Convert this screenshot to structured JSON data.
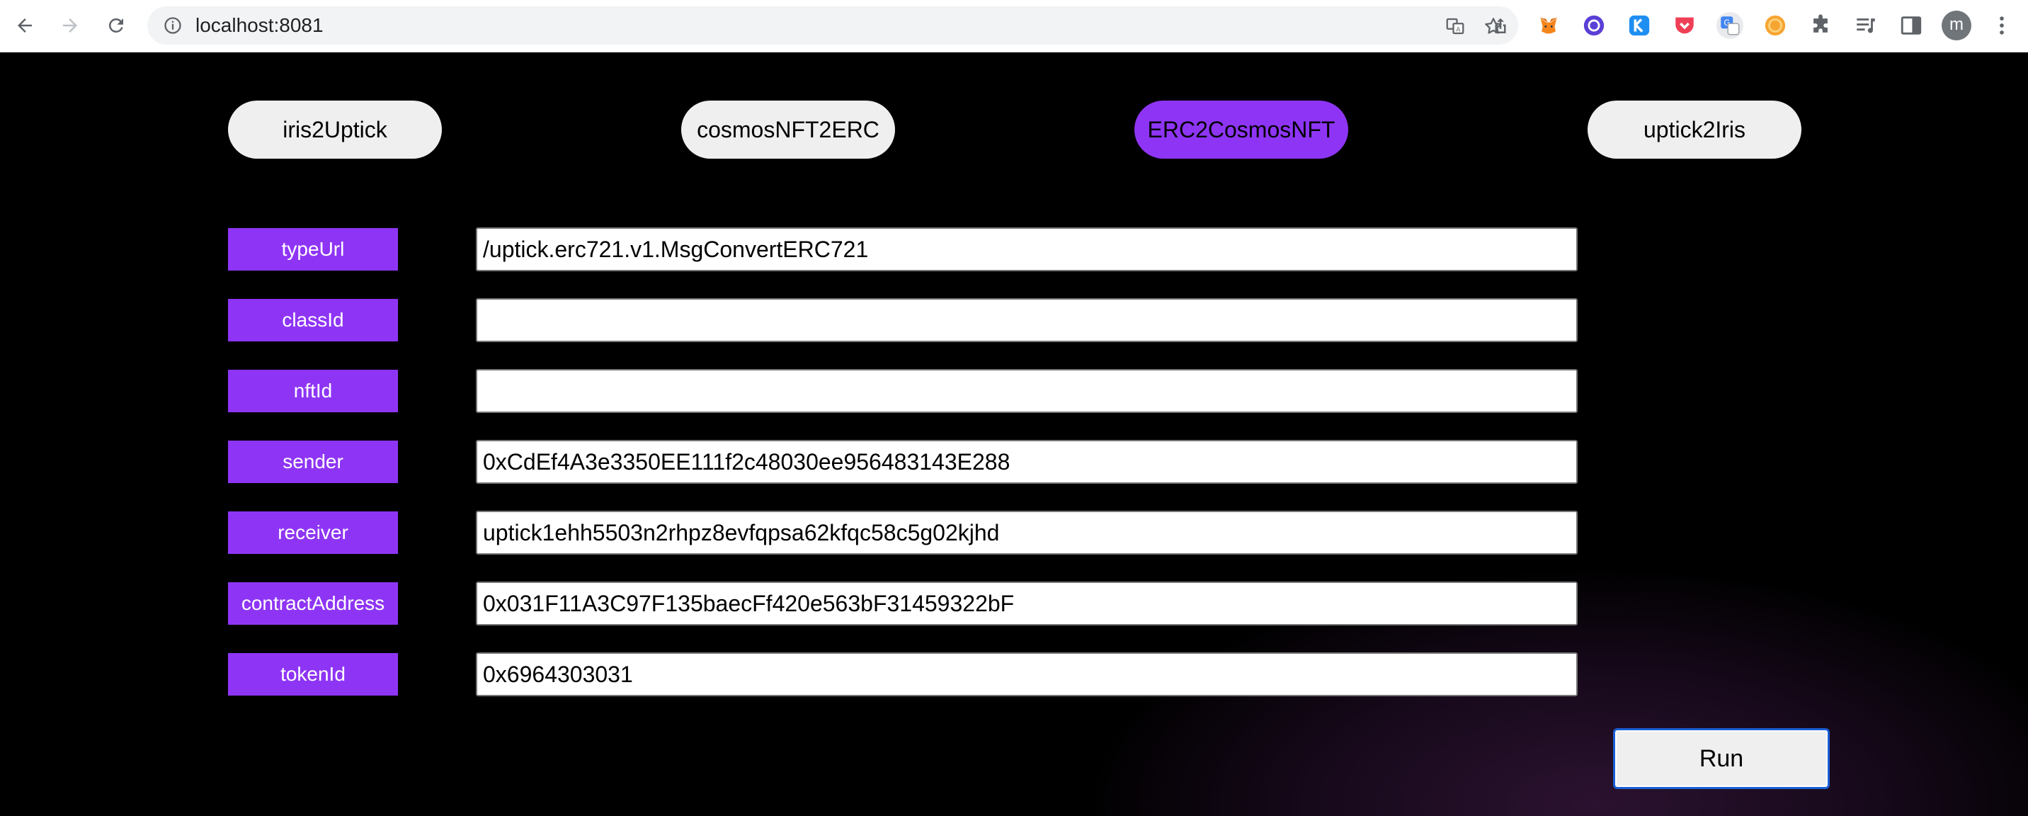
{
  "browser": {
    "url": "localhost:8081",
    "profile_initial": "m"
  },
  "tabs": [
    {
      "label": "iris2Uptick",
      "active": false
    },
    {
      "label": "cosmosNFT2ERC",
      "active": false
    },
    {
      "label": "ERC2CosmosNFT",
      "active": true
    },
    {
      "label": "uptick2Iris",
      "active": false
    }
  ],
  "form": {
    "fields": [
      {
        "label": "typeUrl",
        "value": "/uptick.erc721.v1.MsgConvertERC721"
      },
      {
        "label": "classId",
        "value": ""
      },
      {
        "label": "nftId",
        "value": ""
      },
      {
        "label": "sender",
        "value": "0xCdEf4A3e3350EE111f2c48030ee956483143E288"
      },
      {
        "label": "receiver",
        "value": "uptick1ehh5503n2rhpz8evfqpsa62kfqc58c5g02kjhd"
      },
      {
        "label": "contractAddress",
        "value": "0x031F11A3C97F135baecFf420e563bF31459322bF"
      },
      {
        "label": "tokenId",
        "value": "0x6964303031"
      }
    ],
    "run_label": "Run"
  },
  "colors": {
    "accent": "#8e35f5",
    "tab_bg": "#efefef",
    "page_bg": "#000000"
  }
}
